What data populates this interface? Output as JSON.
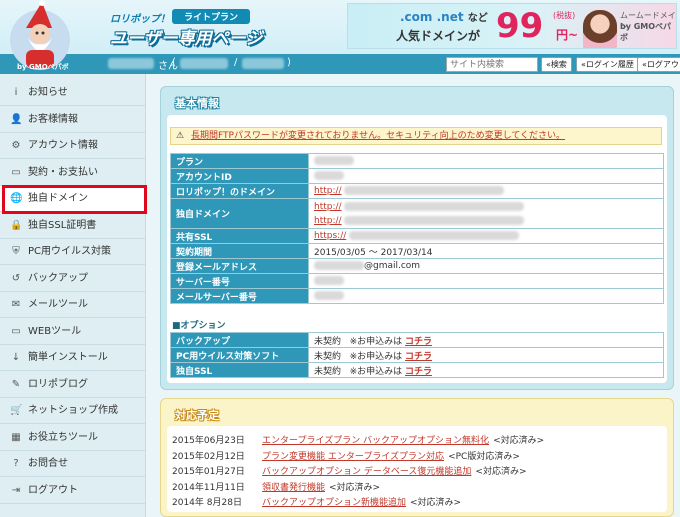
{
  "header": {
    "brand_small": "ロリポップ！",
    "plan_badge": "ライトプラン",
    "site_title": "ユーザー専用ページ",
    "mascot_caption": "by GMOペパボ",
    "banner": {
      "domains": ".com .net",
      "nado": "など",
      "popular": "人気ドメインが",
      "price": "99",
      "tax": "(税抜)",
      "yen": "円~",
      "service": "ムームードメイン",
      "by": "by GMOペパボ"
    }
  },
  "userbar": {
    "san": "さん",
    "paren_open": "(",
    "slash": "/",
    "paren_close": ")",
    "search_placeholder": "サイト内検索",
    "search_btn": "検索",
    "history_btn": "ログイン履歴",
    "logout_btn": "ログアウト"
  },
  "sidebar": {
    "items": [
      {
        "label": "お知らせ",
        "icon": "i"
      },
      {
        "label": "お客様情報",
        "icon": "👤"
      },
      {
        "label": "アカウント情報",
        "icon": "⚙"
      },
      {
        "label": "契約・お支払い",
        "icon": "▭"
      },
      {
        "label": "独自ドメイン",
        "icon": "🌐"
      },
      {
        "label": "独自SSL証明書",
        "icon": "🔒"
      },
      {
        "label": "PC用ウイルス対策",
        "icon": "⛨"
      },
      {
        "label": "バックアップ",
        "icon": "↺"
      },
      {
        "label": "メールツール",
        "icon": "✉"
      },
      {
        "label": "WEBツール",
        "icon": "▭"
      },
      {
        "label": "簡単インストール",
        "icon": "↓"
      },
      {
        "label": "ロリポブログ",
        "icon": "✎"
      },
      {
        "label": "ネットショップ作成",
        "icon": "🛒"
      },
      {
        "label": "お役立ちツール",
        "icon": "▦"
      },
      {
        "label": "お問合せ",
        "icon": "?"
      },
      {
        "label": "ログアウト",
        "icon": "⇥"
      }
    ],
    "active_index": 4,
    "highlight_color": "#e0061b"
  },
  "basic": {
    "title": "基本情報",
    "warning_text": "長期間FTPパスワードが変更されておりません。セキュリティ向上のため変更してください。",
    "rows": [
      {
        "label": "プラン",
        "value": ""
      },
      {
        "label": "アカウントID",
        "value": ""
      },
      {
        "label": "ロリポップ！のドメイン",
        "value": "http://"
      },
      {
        "label": "独自ドメイン",
        "value": "http://",
        "value2": "http://"
      },
      {
        "label": "共有SSL",
        "value": "https://"
      },
      {
        "label": "契約期間",
        "value": "2015/03/05 ～ 2017/03/14"
      },
      {
        "label": "登録メールアドレス",
        "value": "@gmail.com"
      },
      {
        "label": "サーバー番号",
        "value": ""
      },
      {
        "label": "メールサーバー番号",
        "value": ""
      }
    ],
    "option_title": "■オプション",
    "options": [
      {
        "label": "バックアップ",
        "status": "未契約",
        "note": "※お申込みは",
        "link": "コチラ"
      },
      {
        "label": "PC用ウイルス対策ソフト",
        "status": "未契約",
        "note": "※お申込みは",
        "link": "コチラ"
      },
      {
        "label": "独自SSL",
        "status": "未契約",
        "note": "※お申込みは",
        "link": "コチラ"
      }
    ]
  },
  "schedule": {
    "title": "対応予定",
    "items": [
      {
        "date": "2015年06月23日",
        "title": "エンタープライズプラン バックアップオプション無料化",
        "status": "<対応済み>"
      },
      {
        "date": "2015年02月12日",
        "title": "プラン変更機能 エンタープライズプラン対応",
        "status": "<PC版対応済み>"
      },
      {
        "date": "2015年01月27日",
        "title": "バックアップオプション データベース復元機能追加",
        "status": "<対応済み>"
      },
      {
        "date": "2014年11月11日",
        "title": "領収書発行機能",
        "status": "<対応済み>"
      },
      {
        "date": "2014年 8月28日",
        "title": "バックアップオプション新機能追加",
        "status": "<対応済み>"
      }
    ]
  },
  "colors": {
    "accent": "#2f97b8",
    "link": "#c0392b",
    "sidebar_bg": "#dfeef2"
  }
}
